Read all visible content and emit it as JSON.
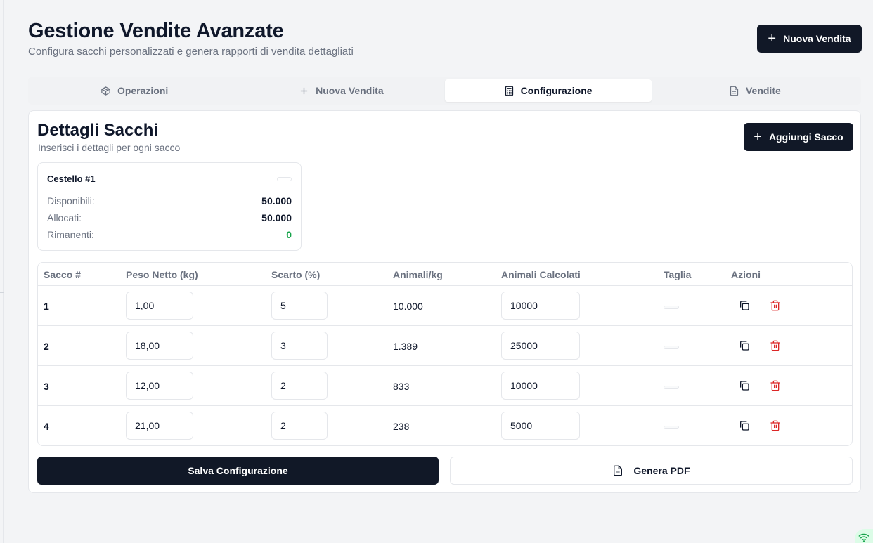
{
  "header": {
    "title": "Gestione Vendite Avanzate",
    "subtitle": "Configura sacchi personalizzati e genera rapporti di vendita dettagliati",
    "new_sale_label": "Nuova Vendita"
  },
  "tabs": [
    {
      "label": "Operazioni",
      "icon": "box-icon",
      "active": false
    },
    {
      "label": "Nuova Vendita",
      "icon": "plus-icon",
      "active": false
    },
    {
      "label": "Configurazione",
      "icon": "calculator-icon",
      "active": true
    },
    {
      "label": "Vendite",
      "icon": "file-text-icon",
      "active": false
    }
  ],
  "card": {
    "title": "Dettagli Sacchi",
    "subtitle": "Inserisci i dettagli per ogni sacco",
    "add_bag_label": "Aggiungi Sacco"
  },
  "cestello": {
    "title": "Cestello #1",
    "stats": [
      {
        "label": "Disponibili:",
        "value": "50.000"
      },
      {
        "label": "Allocati:",
        "value": "50.000"
      },
      {
        "label": "Rimanenti:",
        "value": "0"
      }
    ]
  },
  "table": {
    "headers": [
      "Sacco #",
      "Peso Netto (kg)",
      "Scarto (%)",
      "Animali/kg",
      "Animali Calcolati",
      "Taglia",
      "Azioni"
    ],
    "rows": [
      {
        "id": "1",
        "peso": "1,00",
        "scarto": "5",
        "animali_kg": "10.000",
        "animali_calc": "10000"
      },
      {
        "id": "2",
        "peso": "18,00",
        "scarto": "3",
        "animali_kg": "1.389",
        "animali_calc": "25000"
      },
      {
        "id": "3",
        "peso": "12,00",
        "scarto": "2",
        "animali_kg": "833",
        "animali_calc": "10000"
      },
      {
        "id": "4",
        "peso": "21,00",
        "scarto": "2",
        "animali_kg": "238",
        "animali_calc": "5000"
      }
    ]
  },
  "footer": {
    "save_label": "Salva Configurazione",
    "pdf_label": "Genera PDF"
  },
  "colors": {
    "primary": "#111827",
    "success": "#16a34a",
    "danger": "#dc2626"
  }
}
